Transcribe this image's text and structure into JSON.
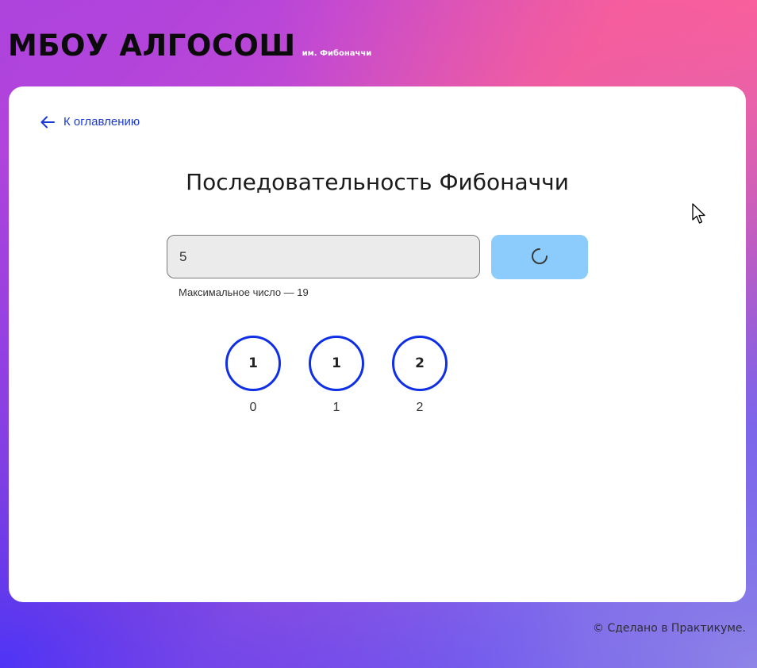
{
  "header": {
    "title": "МБОУ АЛГОСОШ",
    "subtitle": "им. Фибоначчи"
  },
  "nav": {
    "back_label": "К оглавлению",
    "back_icon": "arrow-left-icon"
  },
  "page": {
    "title": "Последовательность Фибоначчи"
  },
  "form": {
    "input_value": "5",
    "hint": "Максимальное число — 19",
    "button_state": "loading",
    "button_icon": "spinner-icon"
  },
  "sequence": [
    {
      "value": "1",
      "index": "0"
    },
    {
      "value": "1",
      "index": "1"
    },
    {
      "value": "2",
      "index": "2"
    }
  ],
  "footer": {
    "text": "© Сделано в Практикуме."
  },
  "colors": {
    "accent": "#0f2fe6",
    "link": "#1a3ad6",
    "button": "#8cccfd"
  }
}
